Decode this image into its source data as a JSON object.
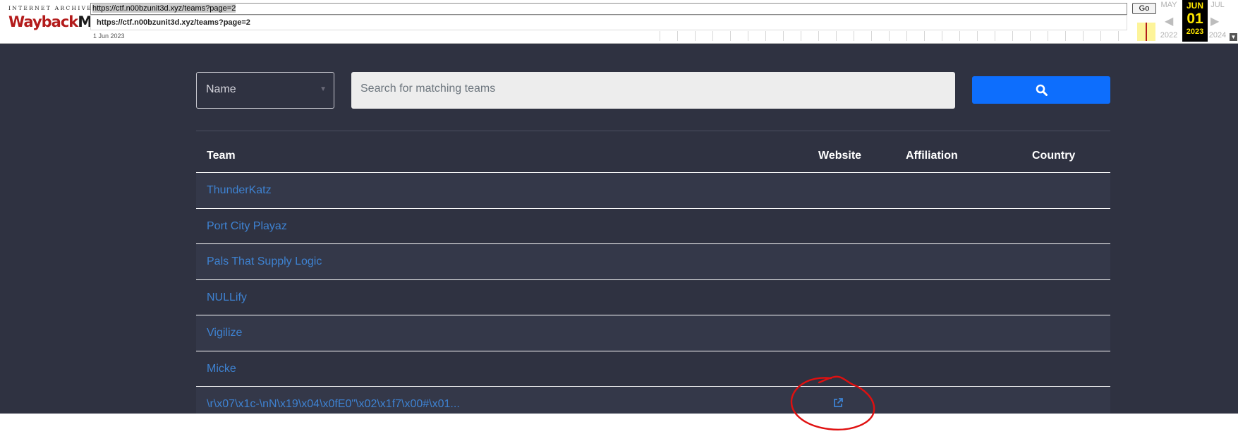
{
  "wayback": {
    "logo_top": "INTERNET ARCHIVE",
    "logo_way": "Wayback",
    "logo_machine": "Machine",
    "url": "https://ctf.n00bzunit3d.xyz/teams?page=2",
    "go_label": "Go",
    "suggestion": "https://ctf.n00bzunit3d.xyz/teams?page=2",
    "capture_date": "1 Jun 2023",
    "prev_month": "MAY",
    "prev_year": "2022",
    "cur_month": "JUN",
    "cur_day": "01",
    "cur_year": "2023",
    "next_month": "JUL",
    "next_year": "2024",
    "accent_color": "#ffe600"
  },
  "search": {
    "field_value": "Name",
    "placeholder": "Search for matching teams",
    "button_icon": "search-icon",
    "button_color": "#0d6efd"
  },
  "table": {
    "headers": {
      "team": "Team",
      "website": "Website",
      "affiliation": "Affiliation",
      "country": "Country"
    },
    "rows": [
      {
        "team": "ThunderKatz",
        "website": ""
      },
      {
        "team": "Port City Playaz",
        "website": ""
      },
      {
        "team": "Pals That Supply Logic",
        "website": ""
      },
      {
        "team": "NULLify",
        "website": ""
      },
      {
        "team": "Vigilize",
        "website": ""
      },
      {
        "team": "Micke",
        "website": ""
      },
      {
        "team": "\\r\\x07\\x1c-\\nN\\x19\\x04\\x0fE0\"\\x02\\x1f7\\x00#\\x01...",
        "website": "external-link-icon"
      }
    ],
    "link_color": "#3e82d1"
  }
}
